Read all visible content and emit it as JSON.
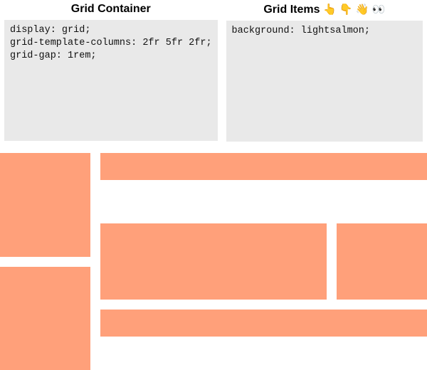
{
  "panels": {
    "container": {
      "title": "Grid Container",
      "code": "display: grid;\ngrid-template-columns: 2fr 5fr 2fr;\ngrid-gap: 1rem;"
    },
    "items": {
      "title": "Grid Items",
      "emoji": "👆 👇 👋 👀",
      "code": "background: lightsalmon;"
    }
  },
  "demo": {
    "item_background": "lightsalmon"
  }
}
